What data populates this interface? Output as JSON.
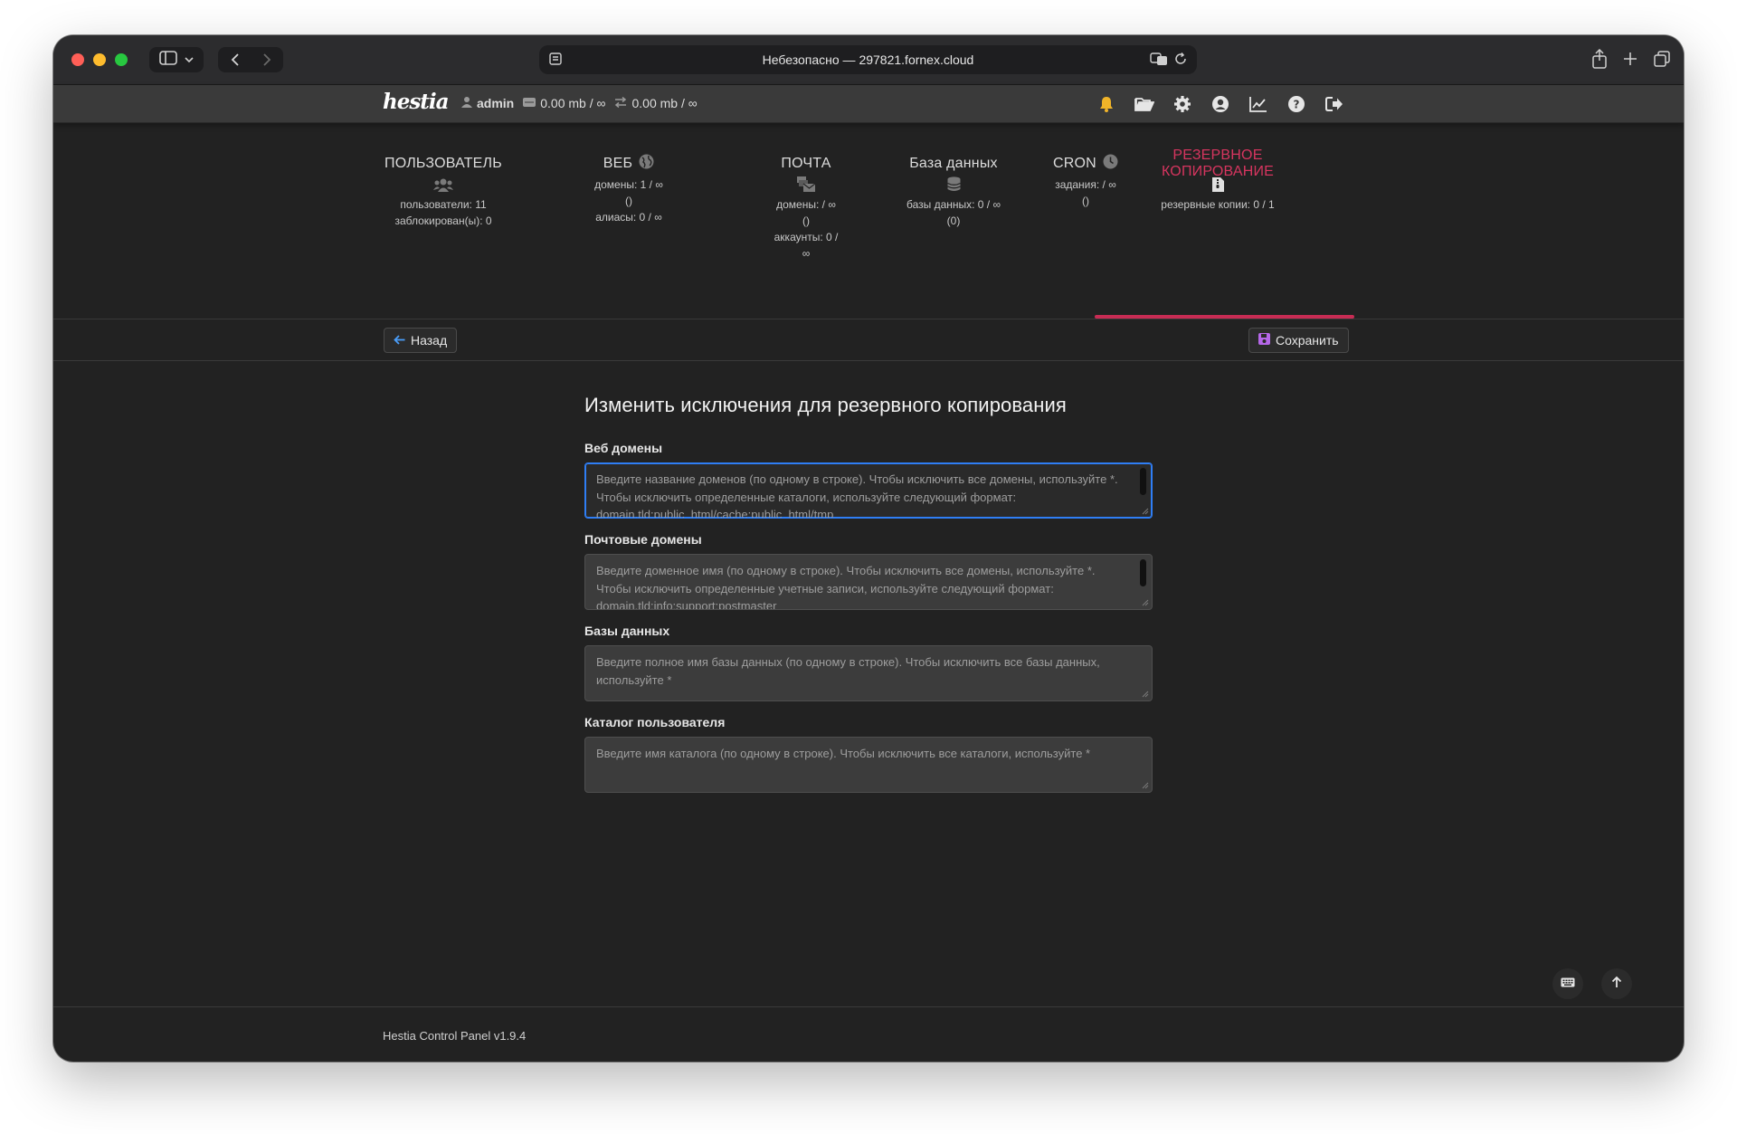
{
  "browser": {
    "address": "Небезопасно — 297821.fornex.cloud"
  },
  "topbar": {
    "logo": "hestia",
    "user": "admin",
    "disk": "0.00 mb / ∞",
    "bandwidth": "0.00 mb / ∞",
    "icons": [
      "bell-icon",
      "folder-open-icon",
      "gear-icon",
      "user-circle-icon",
      "chart-line-icon",
      "question-icon",
      "logout-icon"
    ]
  },
  "stats": [
    {
      "title": "ПОЛЬЗОВАТЕЛЬ",
      "icon": "users-icon",
      "lines": [
        "пользователи: 11",
        "заблокирован(ы): 0"
      ]
    },
    {
      "title": "ВЕБ",
      "icon": "globe-icon",
      "lines": [
        "домены: 1 / ∞",
        "()",
        "алиасы: 0 / ∞"
      ]
    },
    {
      "title": "ПОЧТА",
      "icon": "mail-bulk-icon",
      "lines": [
        "домены: / ∞",
        "()",
        "аккаунты: 0 /",
        "∞"
      ]
    },
    {
      "title": "База данных",
      "icon": "database-icon",
      "lines": [
        "базы данных: 0 / ∞",
        "(0)"
      ]
    },
    {
      "title": "CRON",
      "icon": "clock-icon",
      "lines": [
        "задания: / ∞",
        "()"
      ]
    },
    {
      "title": "РЕЗЕРВНОЕ КОПИРОВАНИЕ",
      "icon": "file-zip-icon",
      "lines": [
        "резервные копии: 0 / 1"
      ],
      "active": true
    }
  ],
  "toolbar": {
    "back_label": "Назад",
    "save_label": "Сохранить"
  },
  "form": {
    "title": "Изменить исключения для резервного копирования",
    "fields": [
      {
        "label": "Веб домены",
        "value": "",
        "placeholder": "Введите название доменов (по одному в строке). Чтобы исключить все домены, используйте *. Чтобы исключить определенные каталоги, используйте следующий формат: domain.tld:public_html/cache:public_html/tmp"
      },
      {
        "label": "Почтовые домены",
        "value": "",
        "placeholder": "Введите доменное имя (по одному в строке). Чтобы исключить все домены, используйте *. Чтобы исключить определенные учетные записи, используйте следующий формат: domain.tld:info:support:postmaster"
      },
      {
        "label": "Базы данных",
        "value": "",
        "placeholder": "Введите полное имя базы данных (по одному в строке). Чтобы исключить все базы данных, используйте *"
      },
      {
        "label": "Каталог пользователя",
        "value": "",
        "placeholder": "Введите имя каталога (по одному в строке). Чтобы исключить все каталоги, используйте *"
      }
    ]
  },
  "footer": {
    "text": "Hestia Control Panel v1.9.4"
  },
  "colors": {
    "accent": "#c72c54",
    "focus": "#2f7ef5",
    "background": "#222222"
  }
}
